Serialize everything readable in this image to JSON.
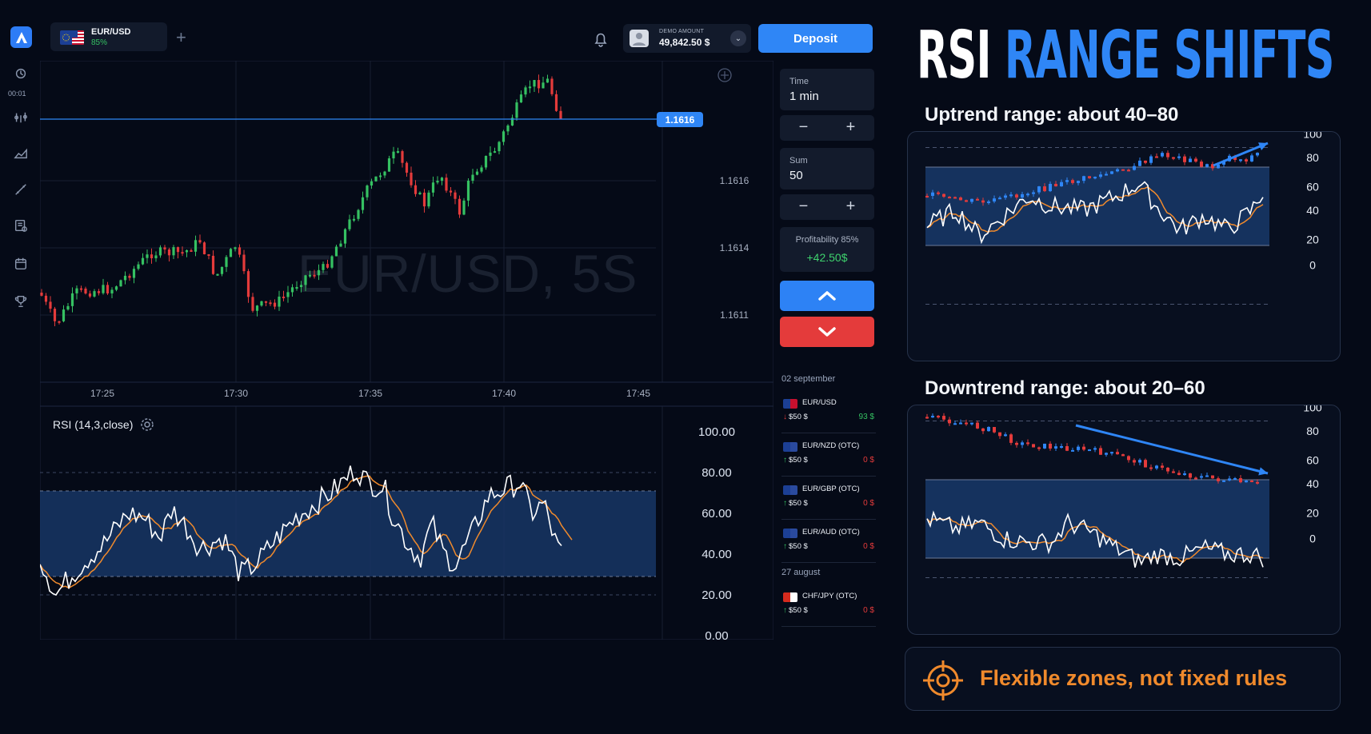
{
  "app": {
    "timer": "00:01"
  },
  "asset_tab": {
    "name": "EUR/USD",
    "payout": "85%"
  },
  "account": {
    "label": "DEMO AMOUNT",
    "balance": "49,842.50 $"
  },
  "deposit_label": "Deposit",
  "price_chart": {
    "watermark": "EUR/USD, 5S",
    "current_price_label": "1.1616",
    "price_ticks": [
      "1.1616",
      "1.1614",
      "1.1611"
    ],
    "time_ticks": [
      "17:25",
      "17:30",
      "17:35",
      "17:40",
      "17:45"
    ]
  },
  "rsi_panel": {
    "label": "RSI (14,3,close)",
    "ticks": [
      "100.00",
      "80.00",
      "60.00",
      "40.00",
      "20.00",
      "0.00"
    ]
  },
  "trade_panel": {
    "time_label": "Time",
    "time_value": "1 min",
    "sum_label": "Sum",
    "sum_value": "50",
    "profit_label": "Profitability 85%",
    "profit_value": "+42.50$"
  },
  "history": {
    "groups": [
      {
        "date": "02 september",
        "items": [
          {
            "name": "EUR/USD",
            "amount": "$50 $",
            "result": "93 $",
            "dir": "down",
            "win": true
          },
          {
            "name": "EUR/NZD (OTC)",
            "amount": "$50 $",
            "result": "0 $",
            "dir": "up",
            "win": false
          },
          {
            "name": "EUR/GBP (OTC)",
            "amount": "$50 $",
            "result": "0 $",
            "dir": "up",
            "win": false
          },
          {
            "name": "EUR/AUD (OTC)",
            "amount": "$50 $",
            "result": "0 $",
            "dir": "up",
            "win": false
          }
        ]
      },
      {
        "date": "27 august",
        "items": [
          {
            "name": "CHF/JPY (OTC)",
            "amount": "$50 $",
            "result": "0 $",
            "dir": "up",
            "win": false
          }
        ]
      }
    ]
  },
  "infographic": {
    "title_white": "RSI",
    "title_blue": "RANGE SHIFTS",
    "uptrend_heading": "Uptrend range: about 40–80",
    "downtrend_heading": "Downtrend range: about 20–60",
    "rsi_scale": [
      "100",
      "80",
      "60",
      "40",
      "20",
      "0"
    ],
    "note": "Flexible zones, not fixed rules"
  },
  "colors": {
    "accent_blue": "#2f86f6",
    "up_green": "#35c162",
    "down_red": "#e43b3b",
    "rsi_band": "#173665",
    "rsi_line": "#ffffff",
    "rsi_signal": "#f08a2c",
    "note_orange": "#f08a2c"
  }
}
